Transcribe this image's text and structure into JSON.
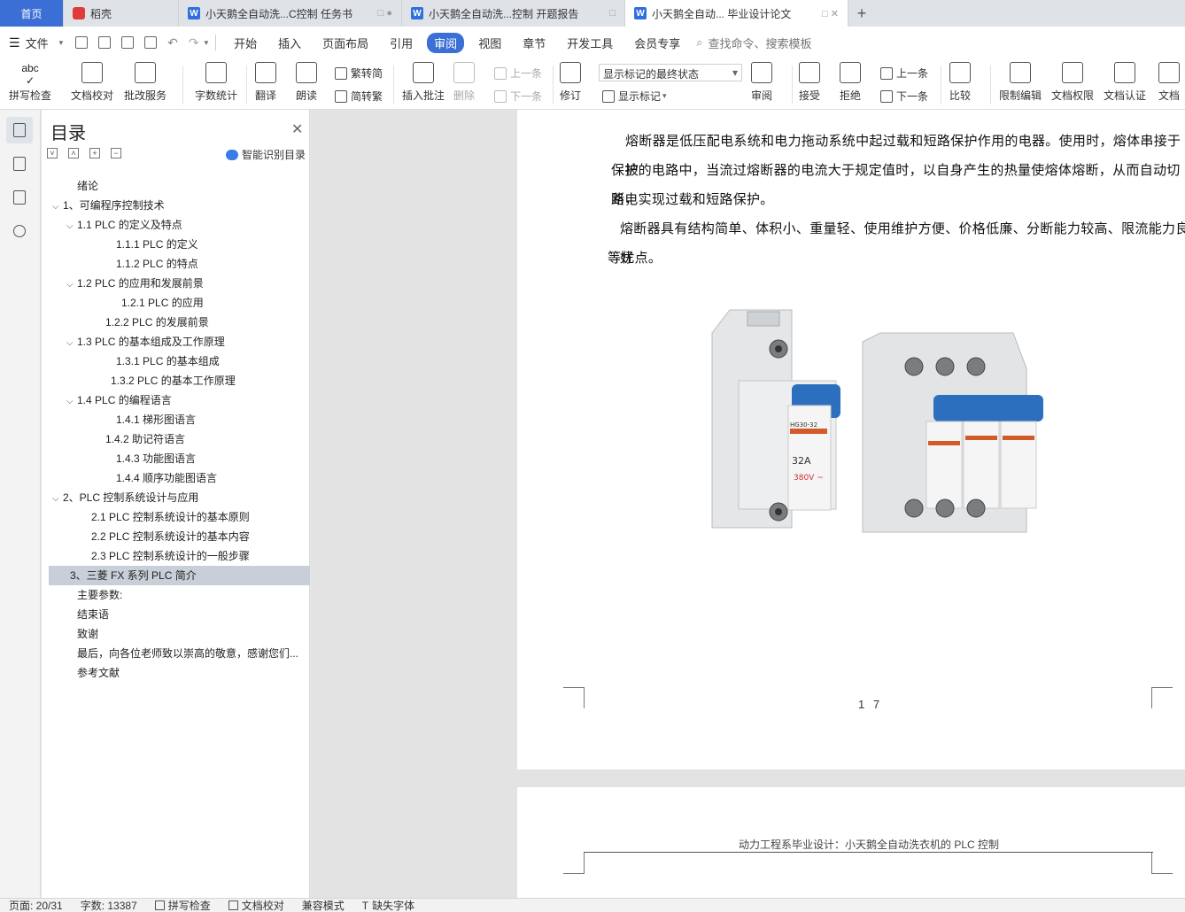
{
  "tabs": {
    "home": "首页",
    "draft": "稻壳",
    "doc1": "小天鹅全自动洗...C控制 任务书",
    "doc2": "小天鹅全自动洗...控制 开题报告",
    "doc3": "小天鹅全自动... 毕业设计论文"
  },
  "menu": {
    "file": "文件",
    "items": [
      "开始",
      "插入",
      "页面布局",
      "引用",
      "审阅",
      "视图",
      "章节",
      "开发工具",
      "会员专享"
    ],
    "search": "查找命令、搜索模板"
  },
  "ribbon": {
    "spell": "拼写检查",
    "proof": "文档校对",
    "revise_service": "批改服务",
    "wordcount": "字数统计",
    "translate": "翻译",
    "read": "朗读",
    "trad_simp": "繁转简",
    "simp_trad": "简转繁",
    "insert_comment": "插入批注",
    "delete": "删除",
    "prev_comment": "上一条",
    "next_comment": "下一条",
    "track": "修订",
    "markup_state": "显示标记的最终状态",
    "show_markup": "显示标记",
    "review": "审阅",
    "accept": "接受",
    "reject": "拒绝",
    "prev": "上一条",
    "next": "下一条",
    "compare": "比较",
    "restrict": "限制编辑",
    "permission": "文档权限",
    "certify": "文档认证",
    "doc_more": "文档"
  },
  "toc": {
    "title": "目录",
    "smart": "智能识别目录",
    "items": [
      {
        "text": "绪论",
        "indent": 28,
        "arrow": ""
      },
      {
        "text": "1、可编程序控制技术",
        "indent": 12,
        "arrow": "v"
      },
      {
        "text": "1.1     PLC 的定义及特点",
        "indent": 28,
        "arrow": "v"
      },
      {
        "text": "1.1.1     PLC 的定义",
        "indent": 72,
        "arrow": ""
      },
      {
        "text": "1.1.2    PLC 的特点",
        "indent": 72,
        "arrow": ""
      },
      {
        "text": "1.2       PLC 的应用和发展前景",
        "indent": 28,
        "arrow": "v"
      },
      {
        "text": "1.2.1    PLC 的应用",
        "indent": 78,
        "arrow": ""
      },
      {
        "text": "1.2.2    PLC 的发展前景",
        "indent": 60,
        "arrow": ""
      },
      {
        "text": "1.3    PLC 的基本组成及工作原理",
        "indent": 28,
        "arrow": "v"
      },
      {
        "text": "1.3.1 PLC 的基本组成",
        "indent": 72,
        "arrow": ""
      },
      {
        "text": "1.3.2    PLC 的基本工作原理",
        "indent": 66,
        "arrow": ""
      },
      {
        "text": "1.4    PLC 的编程语言",
        "indent": 28,
        "arrow": "v"
      },
      {
        "text": "1.4.1  梯形图语言",
        "indent": 72,
        "arrow": ""
      },
      {
        "text": "1.4.2  助记符语言",
        "indent": 60,
        "arrow": ""
      },
      {
        "text": "1.4.3  功能图语言",
        "indent": 72,
        "arrow": ""
      },
      {
        "text": "1.4.4 顺序功能图语言",
        "indent": 72,
        "arrow": ""
      },
      {
        "text": "2、PLC 控制系统设计与应用",
        "indent": 12,
        "arrow": "v"
      },
      {
        "text": "2.1    PLC 控制系统设计的基本原则",
        "indent": 44,
        "arrow": ""
      },
      {
        "text": "2.2    PLC 控制系统设计的基本内容",
        "indent": 44,
        "arrow": ""
      },
      {
        "text": "2.3    PLC 控制系统设计的一般步骤",
        "indent": 44,
        "arrow": ""
      },
      {
        "text": "3、三菱 FX 系列 PLC 简介",
        "indent": 20,
        "arrow": "",
        "selected": true
      },
      {
        "text": "主要参数:",
        "indent": 28,
        "arrow": ""
      },
      {
        "text": "结束语",
        "indent": 28,
        "arrow": ""
      },
      {
        "text": "致谢",
        "indent": 28,
        "arrow": ""
      },
      {
        "text": "最后，向各位老师致以崇高的敬意，感谢您们...",
        "indent": 28,
        "arrow": ""
      },
      {
        "text": "参考文献",
        "indent": 28,
        "arrow": ""
      }
    ]
  },
  "doc": {
    "para1_line1": "熔断器是低压配电系统和电力拖动系统中起过载和短路保护作用的电器。使用时，熔体串接于被",
    "para1_line2": "保护的电路中，当流过熔断器的电流大于规定值时，以自身产生的热量使熔体熔断，从而自动切断电",
    "para1_line3": "路，实现过载和短路保护。",
    "para2_line1": "熔断器具有结构简单、体积小、重量轻、使用维护方便、价格低廉、分断能力较高、限流能力良好",
    "para2_line2": "等优点。",
    "fuse_model": "HG30-32",
    "fuse_rating": "32A",
    "fuse_voltage": "380V ~",
    "page_number": "1 7",
    "next_page_header": "动力工程系毕业设计：小天鹅全自动洗衣机的 PLC 控制"
  },
  "status": {
    "page": "页面: 20/31",
    "words": "字数: 13387",
    "spell": "拼写检查",
    "proof": "文档校对",
    "compat": "兼容模式",
    "missing_font": "缺失字体"
  }
}
